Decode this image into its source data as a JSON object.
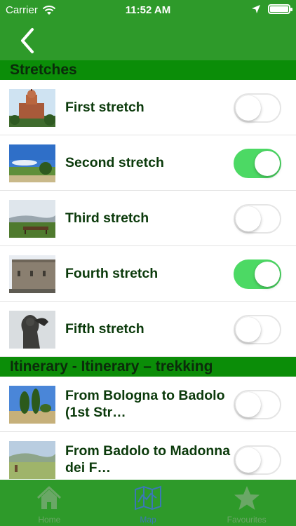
{
  "status": {
    "carrier": "Carrier",
    "time": "11:52 AM"
  },
  "colors": {
    "bar_green": "#2e9a2a",
    "section_green": "#0b8d08",
    "switch_on": "#4cd964",
    "tab_active": "#3b78b4",
    "tab_inactive": "#6aa766"
  },
  "sections": [
    {
      "title": "Stretches",
      "rows": [
        {
          "label": "First stretch",
          "on": false
        },
        {
          "label": "Second stretch",
          "on": true
        },
        {
          "label": "Third stretch",
          "on": false
        },
        {
          "label": "Fourth stretch",
          "on": true
        },
        {
          "label": "Fifth stretch",
          "on": false
        }
      ]
    },
    {
      "title": "Itinerary - Itinerary – trekking",
      "rows": [
        {
          "label": "From Bologna to Badolo (1st Str…",
          "on": false
        },
        {
          "label": "From Badolo to Madonna dei F…",
          "on": false
        }
      ]
    }
  ],
  "tabs": [
    {
      "label": "Home",
      "icon": "home-icon",
      "active": false
    },
    {
      "label": "Map",
      "icon": "map-icon",
      "active": true
    },
    {
      "label": "Favourites",
      "icon": "star-icon",
      "active": false
    }
  ]
}
